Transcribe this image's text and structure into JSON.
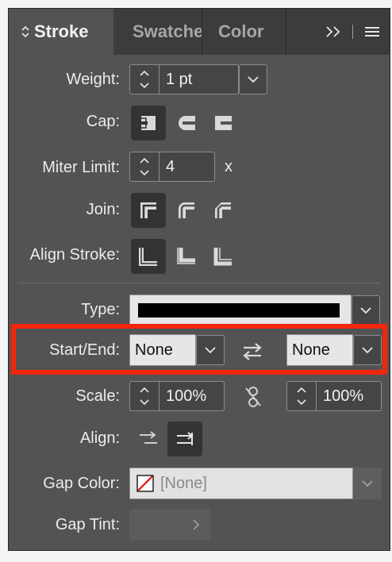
{
  "tabs": {
    "stroke": "Stroke",
    "swatches": "Swatches",
    "color": "Color"
  },
  "fields": {
    "weight": {
      "label": "Weight:",
      "value": "1 pt"
    },
    "cap": {
      "label": "Cap:"
    },
    "miter": {
      "label": "Miter Limit:",
      "value": "4",
      "suffix": "x"
    },
    "join": {
      "label": "Join:"
    },
    "align_stroke": {
      "label": "Align Stroke:"
    },
    "type": {
      "label": "Type:"
    },
    "start_end": {
      "label": "Start/End:",
      "start_value": "None",
      "end_value": "None"
    },
    "scale": {
      "label": "Scale:",
      "start_value": "100%",
      "end_value": "100%"
    },
    "align": {
      "label": "Align:"
    },
    "gap_color": {
      "label": "Gap Color:",
      "value": "[None]"
    },
    "gap_tint": {
      "label": "Gap Tint:"
    }
  },
  "colors": {
    "panel_bg": "#535353",
    "tabbar_bg": "#3c3c3c",
    "highlight": "#f2260c"
  }
}
